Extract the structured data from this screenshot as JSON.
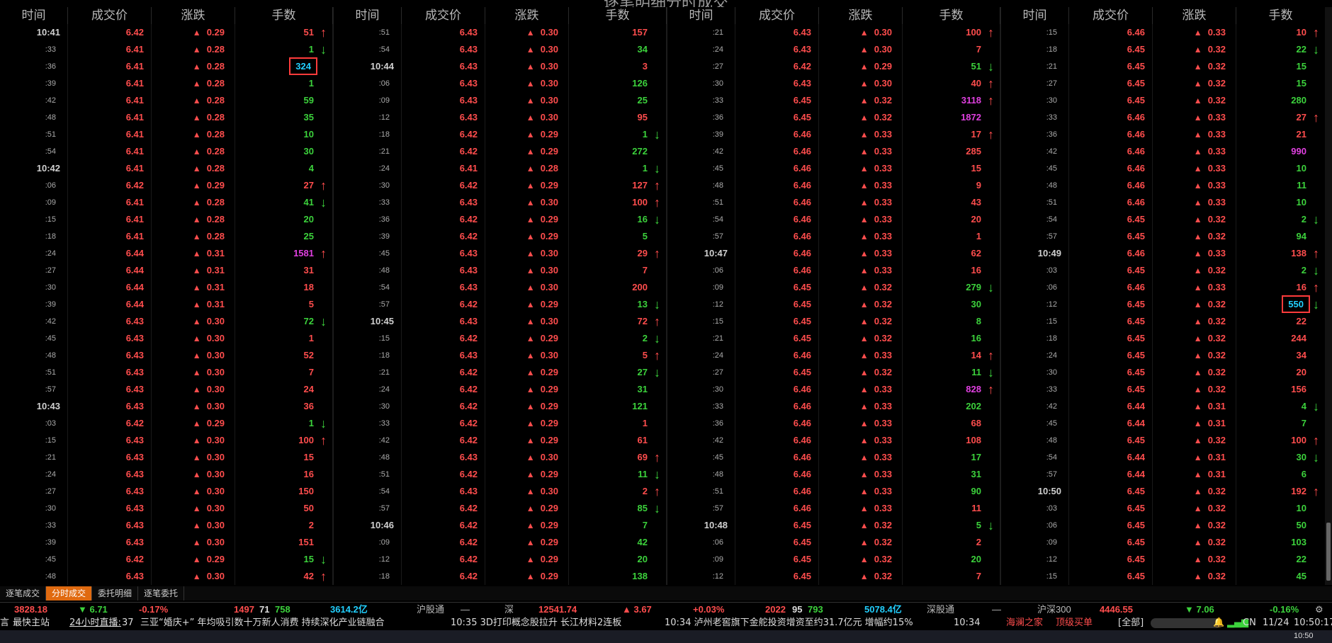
{
  "title": "逐笔明细分时成交",
  "header": [
    "时间",
    "成交价",
    "涨跌",
    "手数"
  ],
  "blocks": [
    [
      [
        "10:41",
        "6.42",
        "0.29",
        "51",
        "red",
        "up"
      ],
      [
        ":33",
        "6.41",
        "0.28",
        "1",
        "green",
        "down"
      ],
      [
        ":36",
        "6.41",
        "0.28",
        "324",
        "cyan",
        "",
        "hl"
      ],
      [
        ":39",
        "6.41",
        "0.28",
        "1",
        "green",
        ""
      ],
      [
        ":42",
        "6.41",
        "0.28",
        "59",
        "green",
        ""
      ],
      [
        ":48",
        "6.41",
        "0.28",
        "35",
        "green",
        ""
      ],
      [
        ":51",
        "6.41",
        "0.28",
        "10",
        "green",
        ""
      ],
      [
        ":54",
        "6.41",
        "0.28",
        "30",
        "green",
        ""
      ],
      [
        "10:42",
        "6.41",
        "0.28",
        "4",
        "green",
        ""
      ],
      [
        ":06",
        "6.42",
        "0.29",
        "27",
        "red",
        "up"
      ],
      [
        ":09",
        "6.41",
        "0.28",
        "41",
        "green",
        "down"
      ],
      [
        ":15",
        "6.41",
        "0.28",
        "20",
        "green",
        ""
      ],
      [
        ":18",
        "6.41",
        "0.28",
        "25",
        "green",
        ""
      ],
      [
        ":24",
        "6.44",
        "0.31",
        "1581",
        "magenta",
        "up"
      ],
      [
        ":27",
        "6.44",
        "0.31",
        "31",
        "red",
        ""
      ],
      [
        ":30",
        "6.44",
        "0.31",
        "18",
        "red",
        ""
      ],
      [
        ":39",
        "6.44",
        "0.31",
        "5",
        "red",
        ""
      ],
      [
        ":42",
        "6.43",
        "0.30",
        "72",
        "green",
        "down"
      ],
      [
        ":45",
        "6.43",
        "0.30",
        "1",
        "red",
        ""
      ],
      [
        ":48",
        "6.43",
        "0.30",
        "52",
        "red",
        ""
      ],
      [
        ":51",
        "6.43",
        "0.30",
        "7",
        "red",
        ""
      ],
      [
        ":57",
        "6.43",
        "0.30",
        "24",
        "red",
        ""
      ],
      [
        "10:43",
        "6.43",
        "0.30",
        "36",
        "red",
        ""
      ],
      [
        ":03",
        "6.42",
        "0.29",
        "1",
        "green",
        "down"
      ],
      [
        ":15",
        "6.43",
        "0.30",
        "100",
        "red",
        "up"
      ],
      [
        ":21",
        "6.43",
        "0.30",
        "15",
        "red",
        ""
      ],
      [
        ":24",
        "6.43",
        "0.30",
        "16",
        "red",
        ""
      ],
      [
        ":27",
        "6.43",
        "0.30",
        "150",
        "red",
        ""
      ],
      [
        ":30",
        "6.43",
        "0.30",
        "50",
        "red",
        ""
      ],
      [
        ":33",
        "6.43",
        "0.30",
        "2",
        "red",
        ""
      ],
      [
        ":39",
        "6.43",
        "0.30",
        "151",
        "red",
        ""
      ],
      [
        ":45",
        "6.42",
        "0.29",
        "15",
        "green",
        "down"
      ],
      [
        ":48",
        "6.43",
        "0.30",
        "42",
        "red",
        "up"
      ]
    ],
    [
      [
        ":51",
        "6.43",
        "0.30",
        "157",
        "red",
        ""
      ],
      [
        ":54",
        "6.43",
        "0.30",
        "34",
        "green",
        ""
      ],
      [
        "10:44",
        "6.43",
        "0.30",
        "3",
        "red",
        ""
      ],
      [
        ":06",
        "6.43",
        "0.30",
        "126",
        "green",
        ""
      ],
      [
        ":09",
        "6.43",
        "0.30",
        "25",
        "green",
        ""
      ],
      [
        ":12",
        "6.43",
        "0.30",
        "95",
        "red",
        ""
      ],
      [
        ":18",
        "6.42",
        "0.29",
        "1",
        "green",
        "down"
      ],
      [
        ":21",
        "6.42",
        "0.29",
        "272",
        "green",
        ""
      ],
      [
        ":24",
        "6.41",
        "0.28",
        "1",
        "green",
        "down"
      ],
      [
        ":30",
        "6.42",
        "0.29",
        "127",
        "red",
        "up"
      ],
      [
        ":33",
        "6.43",
        "0.30",
        "100",
        "red",
        "up"
      ],
      [
        ":36",
        "6.42",
        "0.29",
        "16",
        "green",
        "down"
      ],
      [
        ":39",
        "6.42",
        "0.29",
        "5",
        "green",
        ""
      ],
      [
        ":45",
        "6.43",
        "0.30",
        "29",
        "red",
        "up"
      ],
      [
        ":48",
        "6.43",
        "0.30",
        "7",
        "red",
        ""
      ],
      [
        ":54",
        "6.43",
        "0.30",
        "200",
        "red",
        ""
      ],
      [
        ":57",
        "6.42",
        "0.29",
        "13",
        "green",
        "down"
      ],
      [
        "10:45",
        "6.43",
        "0.30",
        "72",
        "red",
        "up"
      ],
      [
        ":15",
        "6.42",
        "0.29",
        "2",
        "green",
        "down"
      ],
      [
        ":18",
        "6.43",
        "0.30",
        "5",
        "red",
        "up"
      ],
      [
        ":21",
        "6.42",
        "0.29",
        "27",
        "green",
        "down"
      ],
      [
        ":24",
        "6.42",
        "0.29",
        "31",
        "green",
        ""
      ],
      [
        ":30",
        "6.42",
        "0.29",
        "121",
        "green",
        ""
      ],
      [
        ":33",
        "6.42",
        "0.29",
        "1",
        "red",
        ""
      ],
      [
        ":42",
        "6.42",
        "0.29",
        "61",
        "red",
        ""
      ],
      [
        ":48",
        "6.43",
        "0.30",
        "69",
        "red",
        "up"
      ],
      [
        ":51",
        "6.42",
        "0.29",
        "11",
        "green",
        "down"
      ],
      [
        ":54",
        "6.43",
        "0.30",
        "2",
        "red",
        "up"
      ],
      [
        ":57",
        "6.42",
        "0.29",
        "85",
        "green",
        "down"
      ],
      [
        "10:46",
        "6.42",
        "0.29",
        "7",
        "green",
        ""
      ],
      [
        ":09",
        "6.42",
        "0.29",
        "42",
        "green",
        ""
      ],
      [
        ":12",
        "6.42",
        "0.29",
        "20",
        "green",
        ""
      ],
      [
        ":18",
        "6.42",
        "0.29",
        "138",
        "green",
        ""
      ]
    ],
    [
      [
        ":21",
        "6.43",
        "0.30",
        "100",
        "red",
        "up"
      ],
      [
        ":24",
        "6.43",
        "0.30",
        "7",
        "red",
        ""
      ],
      [
        ":27",
        "6.42",
        "0.29",
        "51",
        "green",
        "down"
      ],
      [
        ":30",
        "6.43",
        "0.30",
        "40",
        "red",
        "up"
      ],
      [
        ":33",
        "6.45",
        "0.32",
        "3118",
        "magenta",
        "up"
      ],
      [
        ":36",
        "6.45",
        "0.32",
        "1872",
        "magenta",
        ""
      ],
      [
        ":39",
        "6.46",
        "0.33",
        "17",
        "red",
        "up"
      ],
      [
        ":42",
        "6.46",
        "0.33",
        "285",
        "red",
        ""
      ],
      [
        ":45",
        "6.46",
        "0.33",
        "15",
        "red",
        ""
      ],
      [
        ":48",
        "6.46",
        "0.33",
        "9",
        "red",
        ""
      ],
      [
        ":51",
        "6.46",
        "0.33",
        "43",
        "red",
        ""
      ],
      [
        ":54",
        "6.46",
        "0.33",
        "20",
        "red",
        ""
      ],
      [
        ":57",
        "6.46",
        "0.33",
        "1",
        "red",
        ""
      ],
      [
        "10:47",
        "6.46",
        "0.33",
        "62",
        "red",
        ""
      ],
      [
        ":06",
        "6.46",
        "0.33",
        "16",
        "red",
        ""
      ],
      [
        ":09",
        "6.45",
        "0.32",
        "279",
        "green",
        "down"
      ],
      [
        ":12",
        "6.45",
        "0.32",
        "30",
        "green",
        ""
      ],
      [
        ":15",
        "6.45",
        "0.32",
        "8",
        "green",
        ""
      ],
      [
        ":21",
        "6.45",
        "0.32",
        "16",
        "green",
        ""
      ],
      [
        ":24",
        "6.46",
        "0.33",
        "14",
        "red",
        "up"
      ],
      [
        ":27",
        "6.45",
        "0.32",
        "11",
        "green",
        "down"
      ],
      [
        ":30",
        "6.46",
        "0.33",
        "828",
        "magenta",
        "up"
      ],
      [
        ":33",
        "6.46",
        "0.33",
        "202",
        "green",
        ""
      ],
      [
        ":36",
        "6.46",
        "0.33",
        "68",
        "red",
        ""
      ],
      [
        ":42",
        "6.46",
        "0.33",
        "108",
        "red",
        ""
      ],
      [
        ":45",
        "6.46",
        "0.33",
        "17",
        "green",
        ""
      ],
      [
        ":48",
        "6.46",
        "0.33",
        "31",
        "green",
        ""
      ],
      [
        ":51",
        "6.46",
        "0.33",
        "90",
        "green",
        ""
      ],
      [
        ":57",
        "6.46",
        "0.33",
        "11",
        "red",
        ""
      ],
      [
        "10:48",
        "6.45",
        "0.32",
        "5",
        "green",
        "down"
      ],
      [
        ":06",
        "6.45",
        "0.32",
        "2",
        "red",
        ""
      ],
      [
        ":09",
        "6.45",
        "0.32",
        "20",
        "green",
        ""
      ],
      [
        ":12",
        "6.45",
        "0.32",
        "7",
        "red",
        ""
      ]
    ],
    [
      [
        ":15",
        "6.46",
        "0.33",
        "10",
        "red",
        "up"
      ],
      [
        ":18",
        "6.45",
        "0.32",
        "22",
        "green",
        "down"
      ],
      [
        ":21",
        "6.45",
        "0.32",
        "15",
        "green",
        ""
      ],
      [
        ":27",
        "6.45",
        "0.32",
        "15",
        "green",
        ""
      ],
      [
        ":30",
        "6.45",
        "0.32",
        "280",
        "green",
        ""
      ],
      [
        ":33",
        "6.46",
        "0.33",
        "27",
        "red",
        "up"
      ],
      [
        ":36",
        "6.46",
        "0.33",
        "21",
        "red",
        ""
      ],
      [
        ":42",
        "6.46",
        "0.33",
        "990",
        "magenta",
        ""
      ],
      [
        ":45",
        "6.46",
        "0.33",
        "10",
        "green",
        ""
      ],
      [
        ":48",
        "6.46",
        "0.33",
        "11",
        "green",
        ""
      ],
      [
        ":51",
        "6.46",
        "0.33",
        "10",
        "green",
        ""
      ],
      [
        ":54",
        "6.45",
        "0.32",
        "2",
        "green",
        "down"
      ],
      [
        ":57",
        "6.45",
        "0.32",
        "94",
        "green",
        ""
      ],
      [
        "10:49",
        "6.46",
        "0.33",
        "138",
        "red",
        "up"
      ],
      [
        ":03",
        "6.45",
        "0.32",
        "2",
        "green",
        "down"
      ],
      [
        ":06",
        "6.46",
        "0.33",
        "16",
        "red",
        "up"
      ],
      [
        ":12",
        "6.45",
        "0.32",
        "550",
        "cyan",
        "down",
        "hl"
      ],
      [
        ":15",
        "6.45",
        "0.32",
        "22",
        "red",
        ""
      ],
      [
        ":18",
        "6.45",
        "0.32",
        "244",
        "red",
        ""
      ],
      [
        ":24",
        "6.45",
        "0.32",
        "34",
        "red",
        ""
      ],
      [
        ":30",
        "6.45",
        "0.32",
        "20",
        "red",
        ""
      ],
      [
        ":33",
        "6.45",
        "0.32",
        "156",
        "red",
        ""
      ],
      [
        ":42",
        "6.44",
        "0.31",
        "4",
        "green",
        "down"
      ],
      [
        ":45",
        "6.44",
        "0.31",
        "7",
        "green",
        ""
      ],
      [
        ":48",
        "6.45",
        "0.32",
        "100",
        "red",
        "up"
      ],
      [
        ":54",
        "6.44",
        "0.31",
        "30",
        "green",
        "down"
      ],
      [
        ":57",
        "6.44",
        "0.31",
        "6",
        "green",
        ""
      ],
      [
        "10:50",
        "6.45",
        "0.32",
        "192",
        "red",
        "up"
      ],
      [
        ":03",
        "6.45",
        "0.32",
        "10",
        "green",
        ""
      ],
      [
        ":06",
        "6.45",
        "0.32",
        "50",
        "green",
        ""
      ],
      [
        ":09",
        "6.45",
        "0.32",
        "103",
        "green",
        ""
      ],
      [
        ":12",
        "6.45",
        "0.32",
        "22",
        "green",
        ""
      ],
      [
        ":15",
        "6.45",
        "0.32",
        "45",
        "green",
        ""
      ]
    ]
  ],
  "tabs": [
    "逐笔成交",
    "分时成交",
    "委托明细",
    "逐笔委托"
  ],
  "active_tab": 1,
  "index_bar": {
    "sh_value": "3828.18",
    "sh_change": "▼ 6.71",
    "sh_pct": "-0.17%",
    "sh_up": "1497",
    "sh_flat": "71",
    "sh_down": "758",
    "sh_amount": "3614.2亿",
    "hgt": "沪股通",
    "hgt_val": "—",
    "sz_label": "深",
    "sz_value": "12541.74",
    "sz_change": "▲ 3.67",
    "sz_pct": "+0.03%",
    "sz_up": "2022",
    "sz_flat": "95",
    "sz_down": "793",
    "sz_amount": "5078.4亿",
    "sgt": "深股通",
    "sgt_val": "—",
    "hs300": "沪深300",
    "hs300_value": "4446.55",
    "hs300_change": "▼ 7.06",
    "hs300_pct": "-0.16%"
  },
  "news_bar": {
    "left_label": "言",
    "quick_site": "最快主站",
    "live": "24小时直播:",
    "live_count": "37",
    "items": [
      "三亚“婚庆+”  年均吸引数十万新人消费  持续深化产业链融合",
      "10:35  3D打印概念股拉升  长江材料2连板",
      "10:34  泸州老窖旗下金舵投资增资至约31.7亿元  增幅约15%",
      "10:34"
    ],
    "brand": "海澜之家",
    "brand_note": "顶级买单",
    "filter": "[全部]",
    "lang": "CN",
    "date": "11/24",
    "time": "10:50:17"
  },
  "taskbar_time": "10:50"
}
